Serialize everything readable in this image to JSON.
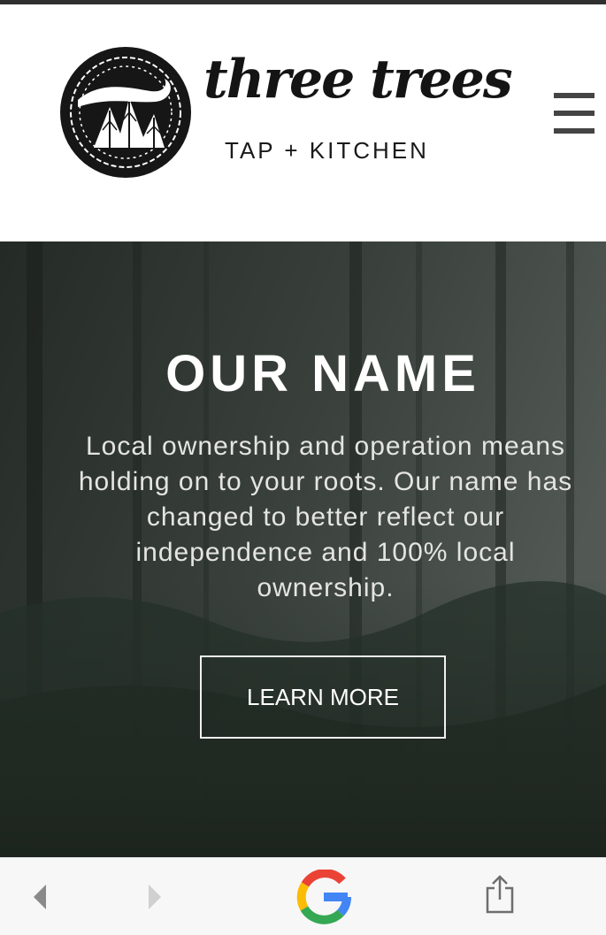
{
  "header": {
    "logo_wordmark": "three trees",
    "logo_tagline": "TAP + KITCHEN",
    "menu_icon": "hamburger-menu-icon"
  },
  "hero": {
    "title": "OUR NAME",
    "text": "Local ownership and operation means\nholding on to your roots. Our name has\nchanged to better reflect our\nindependence and 100% local\nownership.",
    "button_label": "LEARN MORE"
  },
  "browser_toolbar": {
    "icons": [
      "back-arrow-icon",
      "forward-arrow-icon",
      "google-g-icon",
      "share-icon"
    ]
  },
  "colors": {
    "status_bar": "#2f2f2f",
    "hero_overlay": "#2b322d",
    "text_dark": "#141414",
    "google_blue": "#4285F4",
    "google_red": "#EA4335",
    "google_yellow": "#FBBC05",
    "google_green": "#34A853"
  }
}
